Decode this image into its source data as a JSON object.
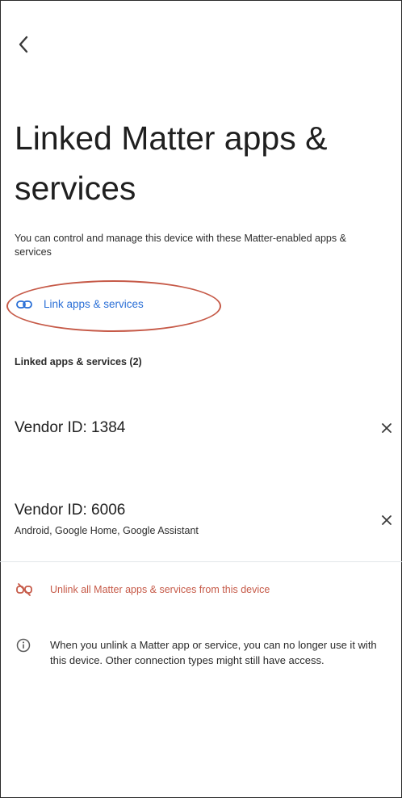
{
  "title": "Linked Matter apps & services",
  "subtitle": "You can control and manage this device with these Matter-enabled apps & services",
  "link_action": "Link apps & services",
  "linked_section": "Linked apps & services (2)",
  "vendors": [
    {
      "name": "Vendor ID: 1384",
      "apps": ""
    },
    {
      "name": "Vendor ID: 6006",
      "apps": "Android, Google Home, Google Assistant"
    }
  ],
  "unlink_action": "Unlink all Matter apps & services from this device",
  "info": "When you unlink a Matter app or service, you can no longer use it with this device. Other connection types might still have access.",
  "colors": {
    "link": "#2a6fd6",
    "danger": "#c65a48",
    "highlight": "#c65a48"
  },
  "icons": {
    "back": "back-arrow-icon",
    "link": "link-icon",
    "remove": "close-icon",
    "unlink": "link-off-icon",
    "info": "info-icon"
  }
}
